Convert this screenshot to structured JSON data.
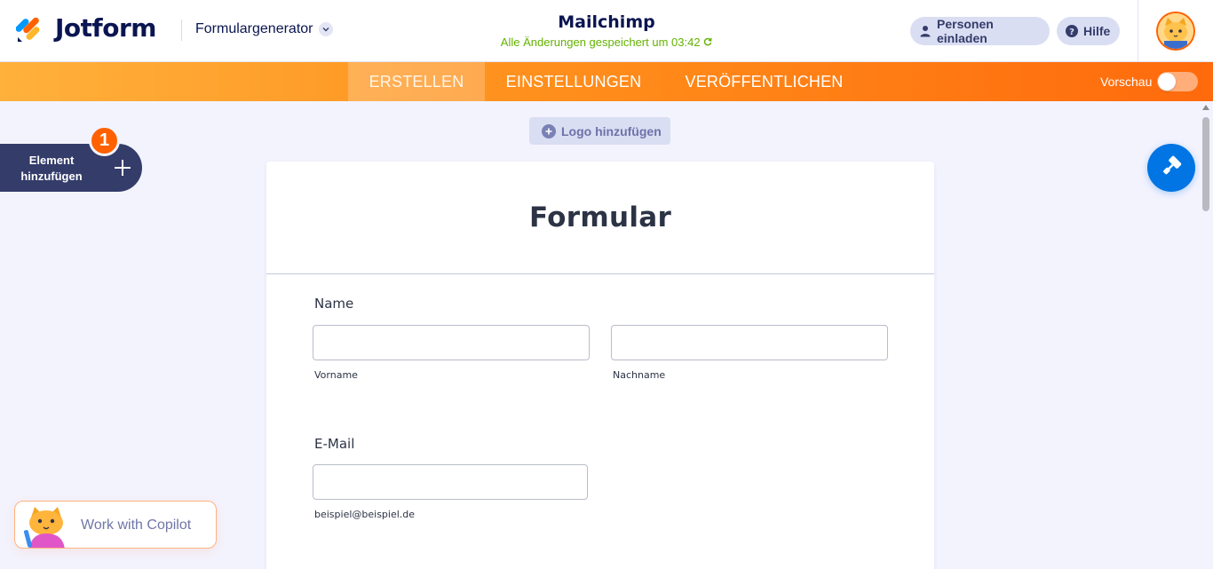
{
  "header": {
    "brand": "Jotform",
    "builder_menu": "Formulargenerator",
    "form_name": "Mailchimp",
    "save_status": "Alle Änderungen gespeichert um 03:42",
    "invite_label": "Personen einladen",
    "help_label": "Hilfe"
  },
  "nav": {
    "tabs": [
      {
        "label": "ERSTELLEN",
        "active": true
      },
      {
        "label": "EINSTELLUNGEN",
        "active": false
      },
      {
        "label": "VERÖFFENTLICHEN",
        "active": false
      }
    ],
    "preview_label": "Vorschau",
    "preview_on": false
  },
  "toolbar": {
    "add_logo_label": "Logo hinzufügen",
    "add_element_line1": "Element",
    "add_element_line2": "hinzufügen",
    "add_element_badge": "1"
  },
  "form": {
    "title": "Formular",
    "name_label": "Name",
    "first_name_value": "",
    "first_name_sublabel": "Vorname",
    "last_name_value": "",
    "last_name_sublabel": "Nachname",
    "email_label": "E-Mail",
    "email_value": "",
    "email_sublabel": "beispiel@beispiel.de"
  },
  "copilot": {
    "label": "Work with Copilot"
  },
  "colors": {
    "brand_orange": "#ff6100",
    "navy": "#0a1551",
    "designer_blue": "#0075e3",
    "saved_green": "#64b200"
  },
  "icons": {
    "logo": "jotform-logo-icon",
    "builder_chevron": "chevron-down-icon",
    "save_status": "refresh-icon",
    "invite": "user-icon",
    "help": "help-circle-icon",
    "add_logo": "plus-circle-icon",
    "add_element": "plus-icon",
    "designer": "paint-roller-icon",
    "copilot": "copilot-cat-icon"
  }
}
